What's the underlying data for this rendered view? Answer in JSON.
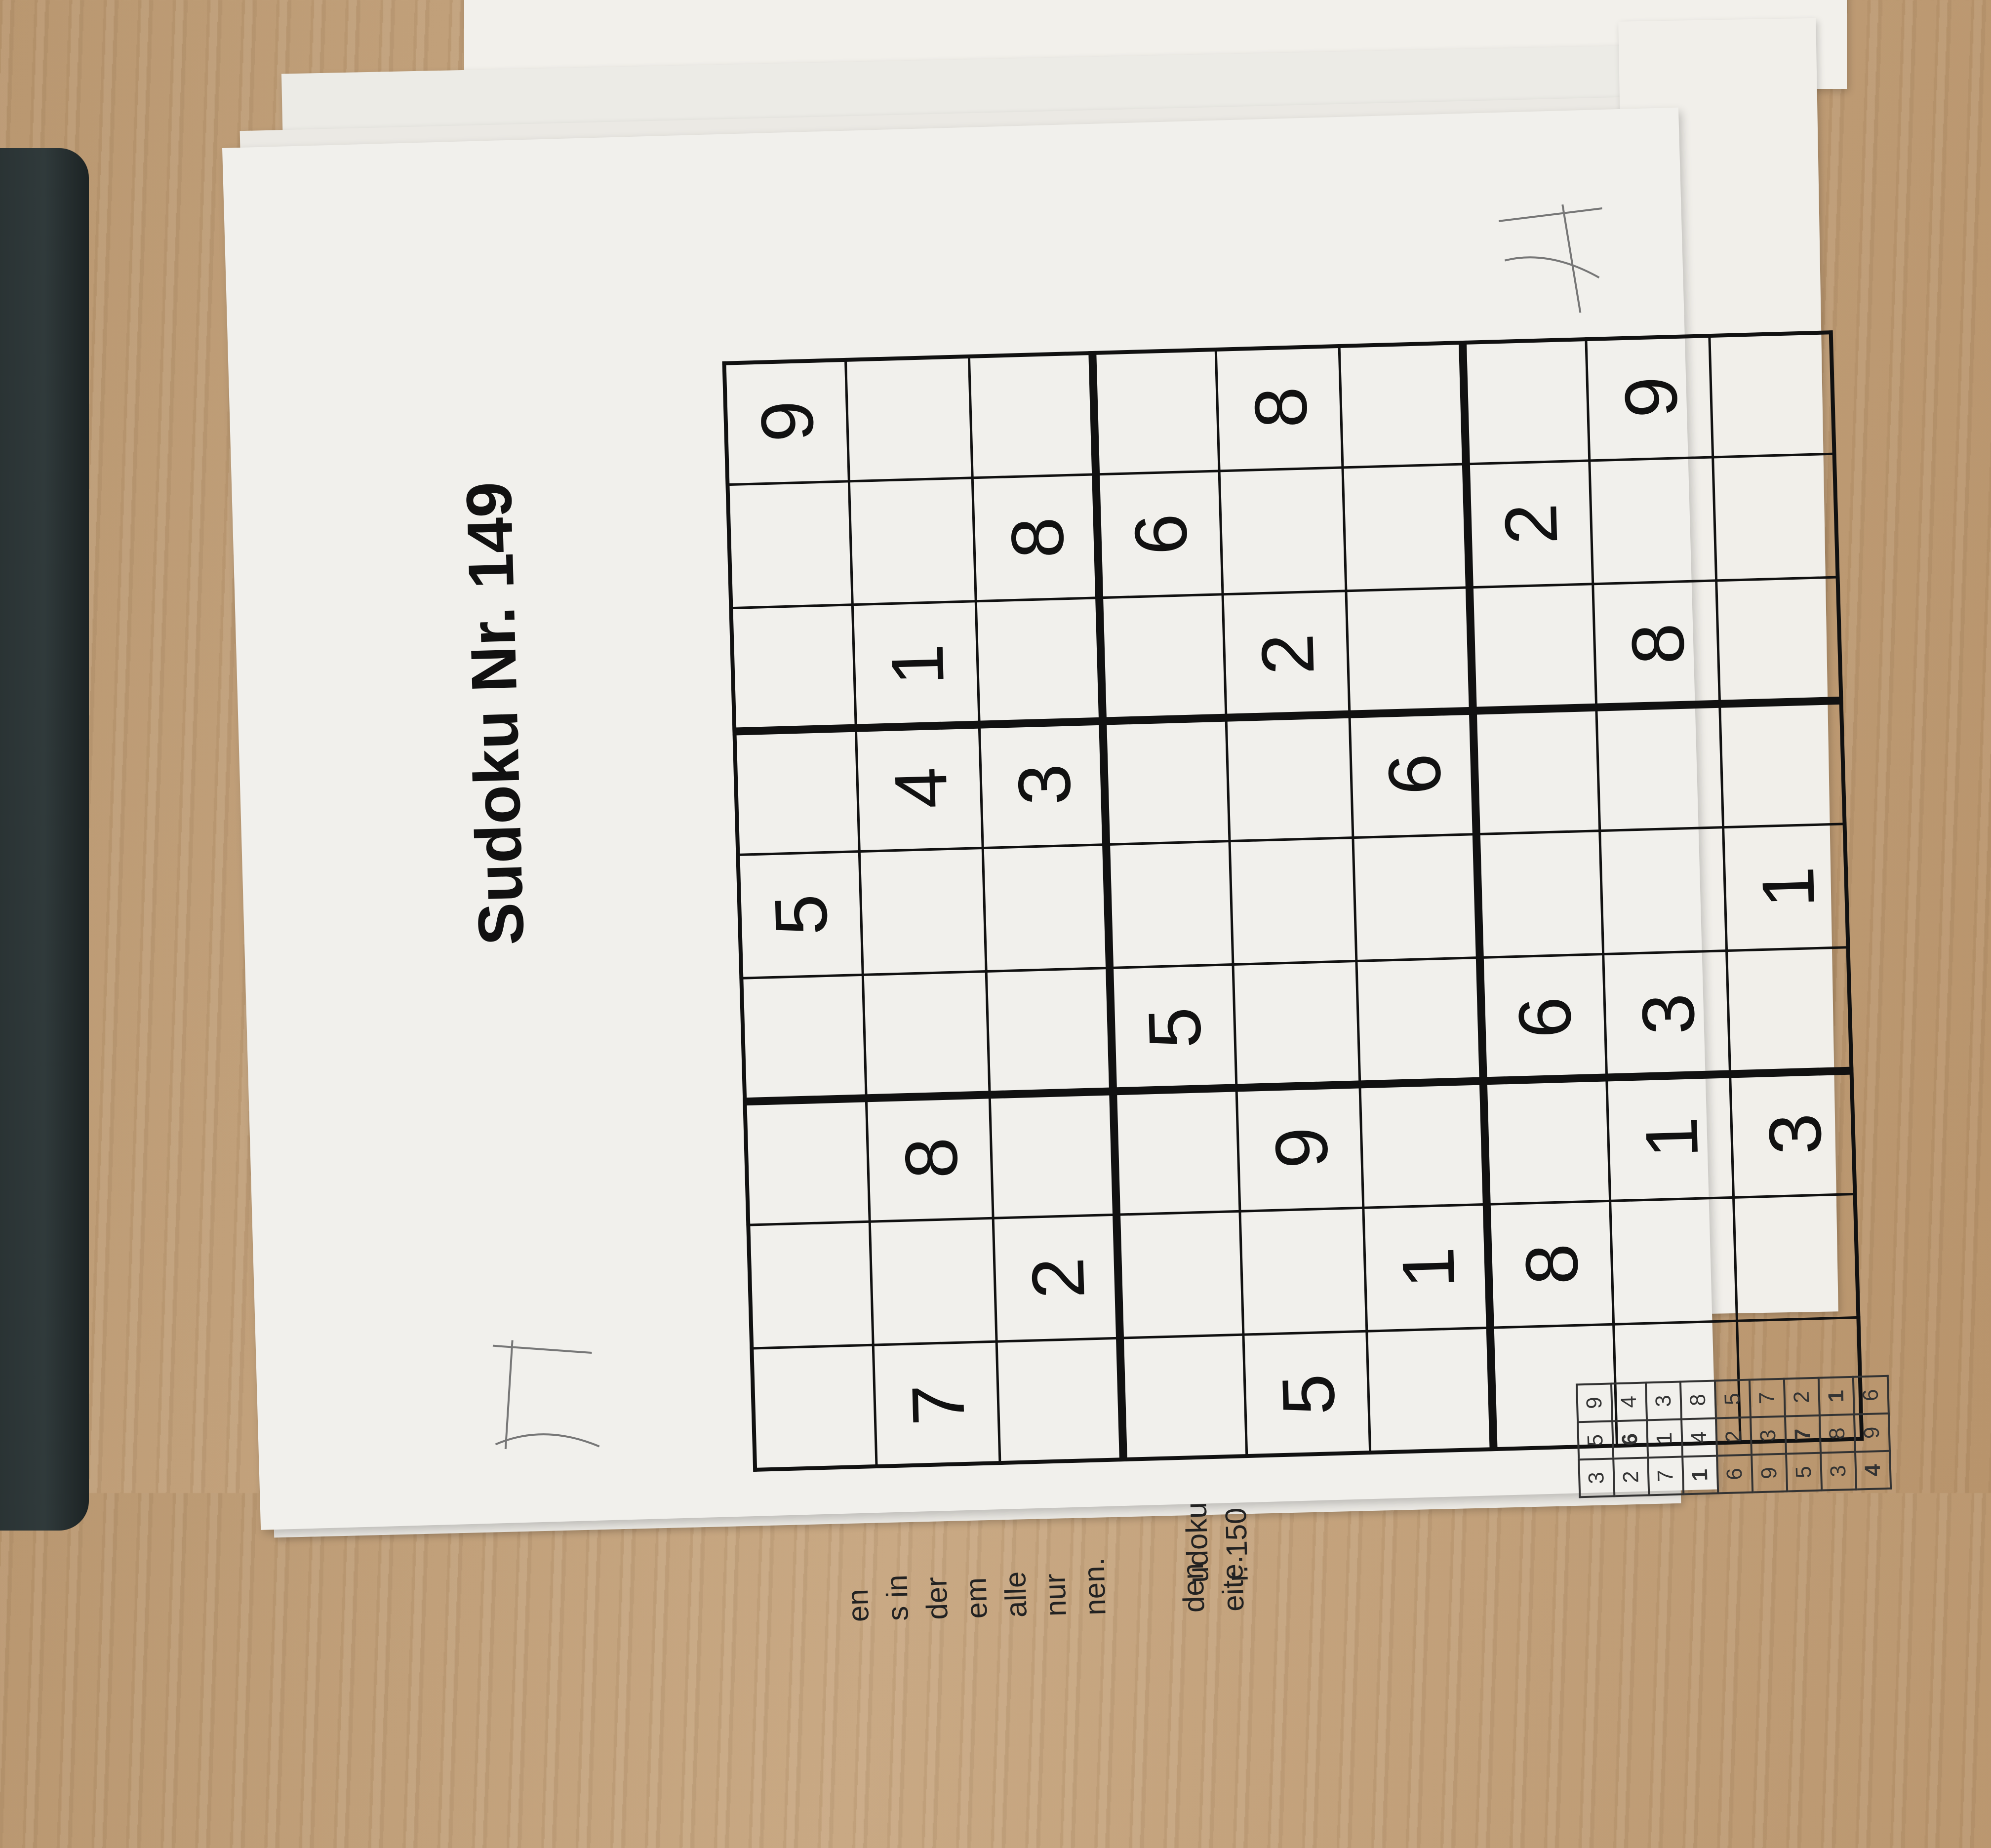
{
  "title": "Sudoku Nr. 149",
  "grid": {
    "rows": [
      [
        "",
        "",
        "",
        "",
        "5",
        "",
        "",
        "",
        "9"
      ],
      [
        "7",
        "",
        "8",
        "",
        "",
        "4",
        "1",
        "",
        ""
      ],
      [
        "",
        "2",
        "",
        "",
        "",
        "3",
        "",
        "8",
        ""
      ],
      [
        "",
        "",
        "",
        "5",
        "",
        "",
        "",
        "6",
        ""
      ],
      [
        "5",
        "",
        "9",
        "",
        "",
        "",
        "2",
        "",
        "8"
      ],
      [
        "",
        "1",
        "",
        "",
        "",
        "6",
        "",
        "",
        ""
      ],
      [
        "",
        "8",
        "",
        "6",
        "",
        "",
        "",
        "2",
        ""
      ],
      [
        "",
        "",
        "1",
        "3",
        "",
        "",
        "8",
        "",
        "9"
      ],
      [
        "",
        "",
        "3",
        "",
        "1",
        "",
        "",
        "",
        ""
      ]
    ]
  },
  "instructions_fragments": [
    "en",
    "s in",
    "der",
    "em",
    "alle",
    "nur",
    "nen.",
    "den",
    "eite."
  ],
  "solution_caption": [
    "udoku",
    "r. 150"
  ],
  "solution_preview": [
    [
      "3",
      "5",
      "9"
    ],
    [
      "2",
      "6",
      "4"
    ],
    [
      "7",
      "1",
      "3"
    ],
    [
      "1",
      "4",
      "8"
    ],
    [
      "6",
      "2",
      "5"
    ],
    [
      "9",
      "3",
      "7"
    ],
    [
      "5",
      "7",
      "2"
    ],
    [
      "3",
      "8",
      "1"
    ],
    [
      "4",
      "9",
      "6"
    ]
  ],
  "colors": {
    "ink": "#111111",
    "paper": "#f1f0ec",
    "pencil": "#bdbdbd"
  }
}
